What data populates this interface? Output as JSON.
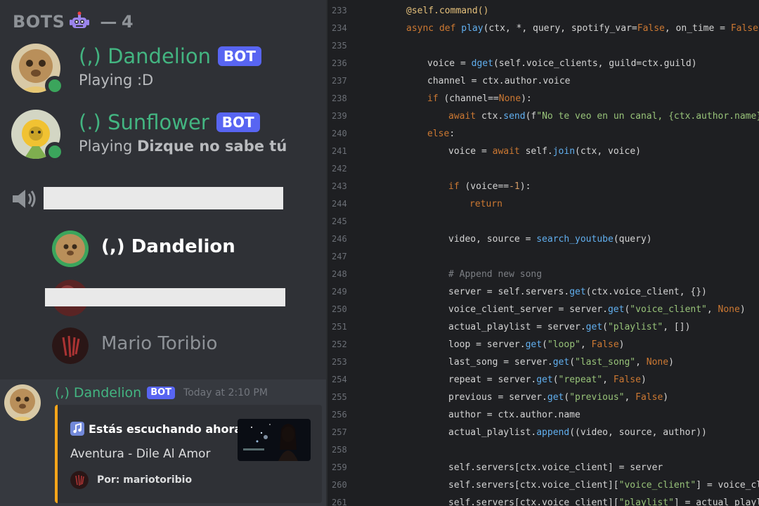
{
  "discord": {
    "members_header": {
      "label": "BOTS",
      "separator": "—",
      "count": "4"
    },
    "bots": [
      {
        "name": "(,) Dandelion",
        "tag": "BOT",
        "activity_prefix": "Playing",
        "activity": ":D"
      },
      {
        "name": "(.) Sunflower",
        "tag": "BOT",
        "activity_prefix": "Playing",
        "activity": "Dizque no sabe tú"
      }
    ],
    "voice_users": [
      {
        "name": "(,) Dandelion"
      },
      {
        "name": "Mario Toribio"
      }
    ],
    "message": {
      "author": "(,) Dandelion",
      "tag": "BOT",
      "timestamp": "Today at 2:10 PM",
      "embed": {
        "title": "Estás escuchando ahora:",
        "description": "Aventura - Dile Al Amor",
        "footer": "Por: mariotoribio",
        "accent_color": "#faa61a"
      }
    }
  },
  "editor": {
    "lines": [
      {
        "n": "233",
        "html": "<span class=\"dec\">@self.command()</span>",
        "indent": 0
      },
      {
        "n": "234",
        "html": "<span class=\"kw\">async def</span> <span class=\"fn\">play</span>(ctx, *, query, spotify_var=<span class=\"kw\">False</span>, on_time = <span class=\"kw\">False</span>):",
        "indent": 0
      },
      {
        "n": "235",
        "html": "",
        "indent": 0
      },
      {
        "n": "236",
        "html": "voice = <span class=\"fn\">dget</span>(self.voice_clients, guild=ctx.guild)",
        "indent": 1
      },
      {
        "n": "237",
        "html": "channel = ctx.author.voice",
        "indent": 1
      },
      {
        "n": "238",
        "html": "<span class=\"kw\">if</span> (channel==<span class=\"kw\">None</span>):",
        "indent": 1
      },
      {
        "n": "239",
        "html": "<span class=\"kw\">await</span> ctx.<span class=\"fn\">send</span>(f<span class=\"str\">\"No te veo en un canal, {ctx.author.name}.\"</span>)",
        "indent": 2
      },
      {
        "n": "240",
        "html": "<span class=\"kw\">else</span>:",
        "indent": 1
      },
      {
        "n": "241",
        "html": "voice = <span class=\"kw\">await</span> self.<span class=\"fn\">join</span>(ctx, voice)",
        "indent": 2
      },
      {
        "n": "242",
        "html": "",
        "indent": 0
      },
      {
        "n": "243",
        "html": "<span class=\"kw\">if</span> (voice==<span class=\"num\">-1</span>):",
        "indent": 2
      },
      {
        "n": "244",
        "html": "<span class=\"kw\">return</span>",
        "indent": 3
      },
      {
        "n": "245",
        "html": "",
        "indent": 0
      },
      {
        "n": "246",
        "html": "video, source = <span class=\"fn\">search_youtube</span>(query)",
        "indent": 2
      },
      {
        "n": "247",
        "html": "",
        "indent": 0
      },
      {
        "n": "248",
        "html": "<span class=\"cm\"># Append new song</span>",
        "indent": 2
      },
      {
        "n": "249",
        "html": "server = self.servers.<span class=\"fn\">get</span>(ctx.voice_client, {})",
        "indent": 2
      },
      {
        "n": "250",
        "html": "voice_client_server = server.<span class=\"fn\">get</span>(<span class=\"str\">\"voice_client\"</span>, <span class=\"kw\">None</span>)",
        "indent": 2
      },
      {
        "n": "251",
        "html": "actual_playlist = server.<span class=\"fn\">get</span>(<span class=\"str\">\"playlist\"</span>, [])",
        "indent": 2
      },
      {
        "n": "252",
        "html": "loop = server.<span class=\"fn\">get</span>(<span class=\"str\">\"loop\"</span>, <span class=\"kw\">False</span>)",
        "indent": 2
      },
      {
        "n": "253",
        "html": "last_song = server.<span class=\"fn\">get</span>(<span class=\"str\">\"last_song\"</span>, <span class=\"kw\">None</span>)",
        "indent": 2
      },
      {
        "n": "254",
        "html": "repeat = server.<span class=\"fn\">get</span>(<span class=\"str\">\"repeat\"</span>, <span class=\"kw\">False</span>)",
        "indent": 2
      },
      {
        "n": "255",
        "html": "previous = server.<span class=\"fn\">get</span>(<span class=\"str\">\"previous\"</span>, <span class=\"kw\">False</span>)",
        "indent": 2
      },
      {
        "n": "256",
        "html": "author = ctx.author.name",
        "indent": 2
      },
      {
        "n": "257",
        "html": "actual_playlist.<span class=\"fn\">append</span>((video, source, author))",
        "indent": 2
      },
      {
        "n": "258",
        "html": "",
        "indent": 0
      },
      {
        "n": "259",
        "html": "self.servers[ctx.voice_client] = server",
        "indent": 2
      },
      {
        "n": "260",
        "html": "self.servers[ctx.voice_client][<span class=\"str\">\"voice_client\"</span>] = voice_client_server",
        "indent": 2
      },
      {
        "n": "261",
        "html": "self.servers[ctx.voice_client][<span class=\"str\">\"playlist\"</span>] = actual_playlist",
        "indent": 2
      }
    ]
  }
}
